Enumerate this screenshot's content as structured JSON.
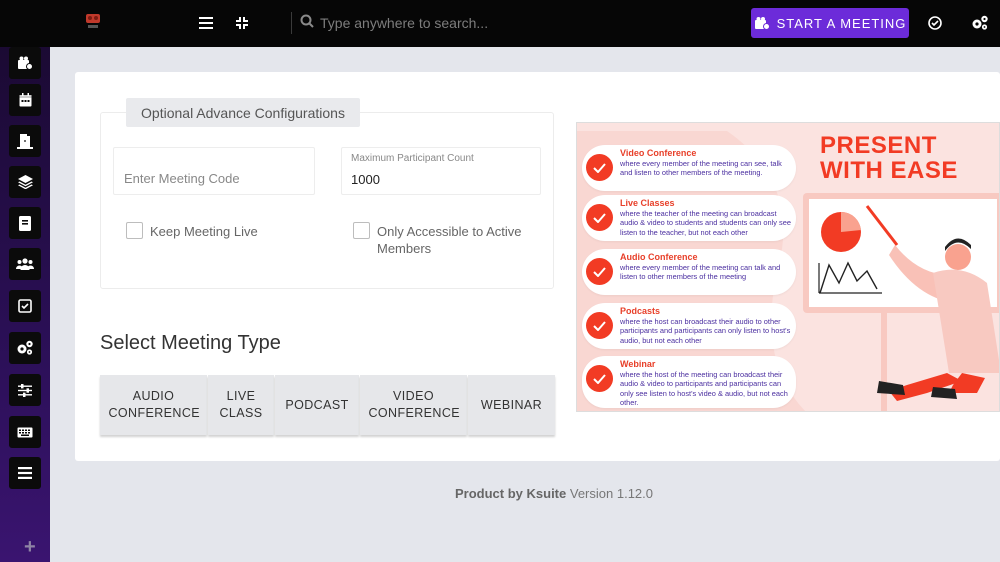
{
  "topbar": {
    "search_placeholder": "Type anywhere to search...",
    "start_meeting_label": "START A MEETING",
    "accent": "#6c2bd9"
  },
  "sidebar": {
    "items": [
      "meeting-icon",
      "calendar-icon",
      "door-icon",
      "layers-icon",
      "book-icon",
      "users-icon",
      "checkbox-icon",
      "cogs-icon",
      "sliders-icon",
      "keyboard-icon",
      "list-icon"
    ],
    "add_label": "+"
  },
  "config": {
    "section_title": "Optional Advance Configurations",
    "meeting_code_placeholder": "Enter Meeting Code",
    "max_participant_label": "Maximum Participant Count",
    "max_participant_value": "1000",
    "keep_live_label": "Keep Meeting Live",
    "active_members_label": "Only Accessible to Active Members"
  },
  "meeting_type": {
    "title": "Select Meeting Type",
    "options": [
      "AUDIO CONFERENCE",
      "LIVE CLASS",
      "PODCAST",
      "VIDEO CONFERENCE",
      "WEBINAR"
    ]
  },
  "promo": {
    "headline_line1": "PRESENT",
    "headline_line2": "WITH EASE",
    "items": [
      {
        "title": "Video Conference",
        "desc": "where every member of the meeting can see, talk and listen to other members of the meeting."
      },
      {
        "title": "Live Classes",
        "desc": "where the teacher of the meeting can broadcast audio & video to students and students can only see listen to the teacher, but not each other"
      },
      {
        "title": "Audio Conference",
        "desc": "where every member of the meeting can talk and listen to other members of the meeting"
      },
      {
        "title": "Podcasts",
        "desc": "where the host can broadcast their audio to other participants and participants can only listen to host's audio, but not each other"
      },
      {
        "title": "Webinar",
        "desc": "where the host of the meeting can broadcast their audio & video to participants and participants can only see listen to host's video & audio, but not each other."
      }
    ]
  },
  "footer": {
    "product": "Product by Ksuite",
    "version": "Version 1.12.0"
  }
}
